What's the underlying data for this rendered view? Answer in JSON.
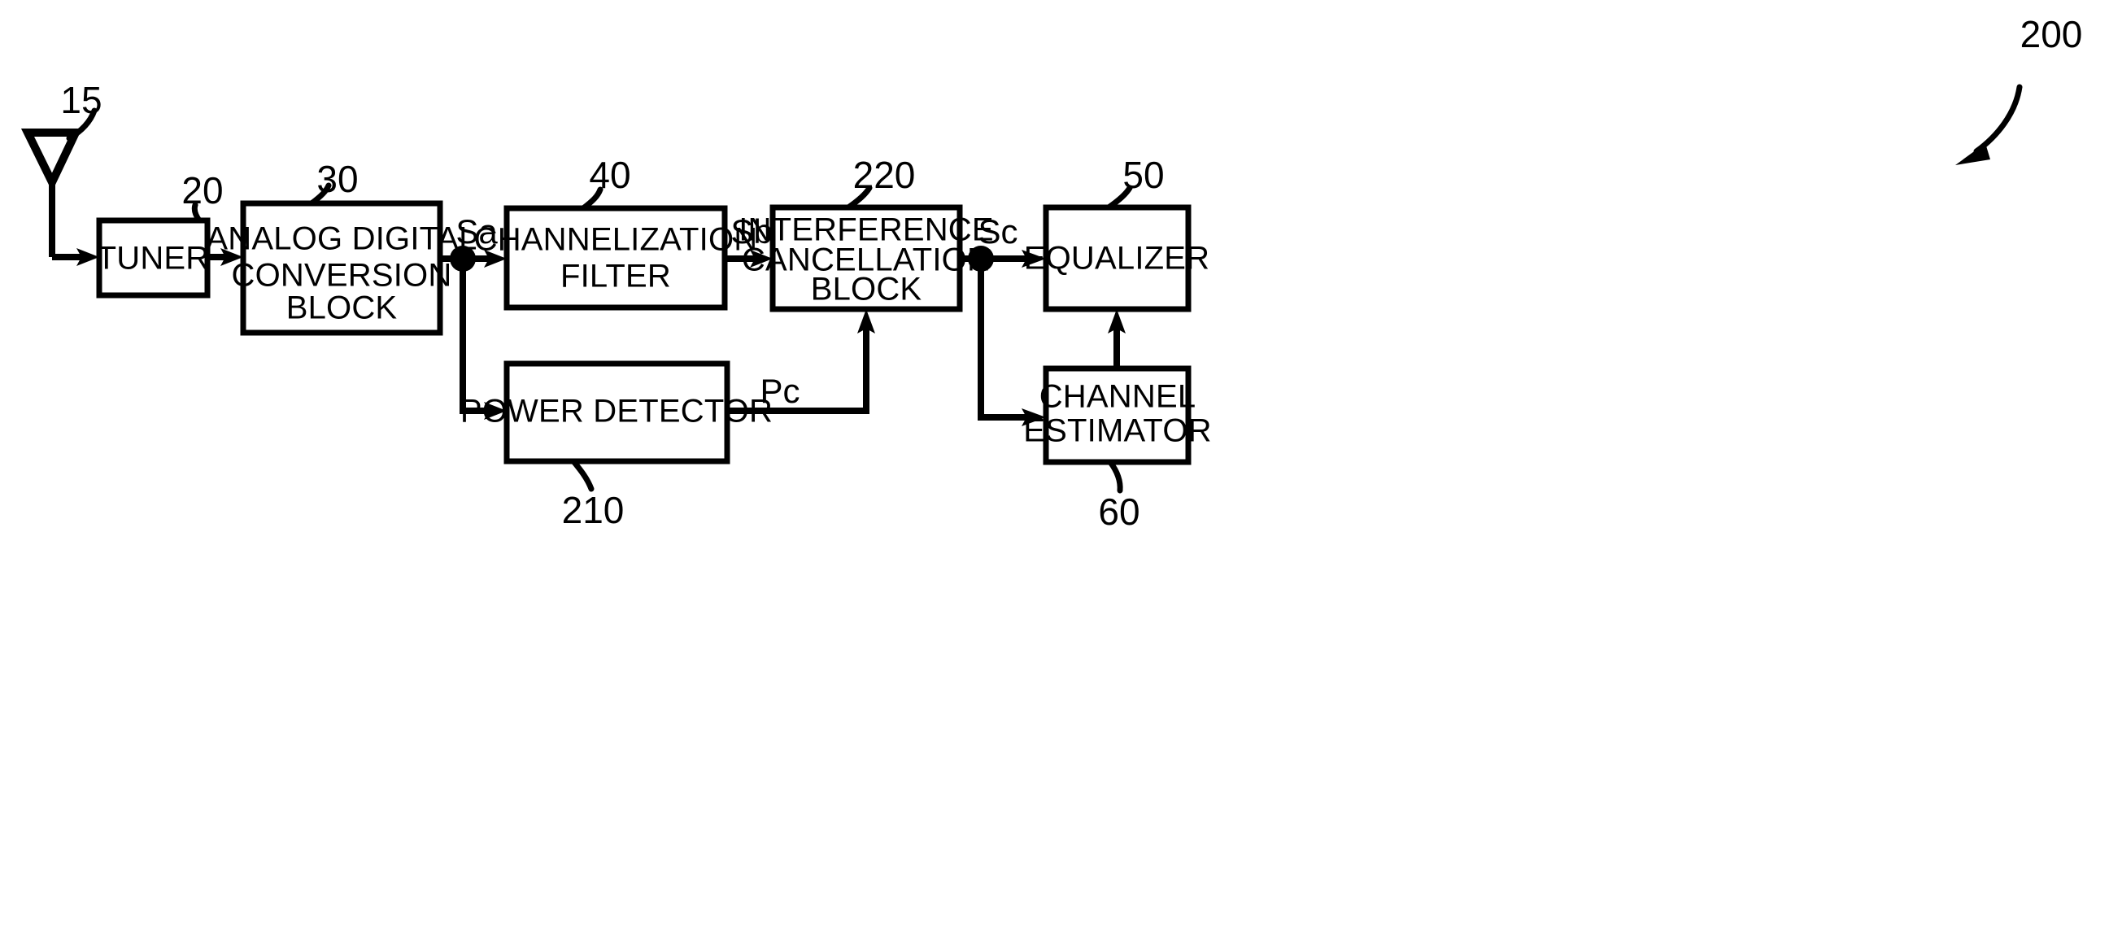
{
  "figure": {
    "kind": "block-diagram",
    "overall_reference": "200",
    "line_color": "#000000",
    "background_color": "#ffffff"
  },
  "blocks": [
    {
      "id": "tuner",
      "lines": [
        "TUNER"
      ],
      "reference": "20"
    },
    {
      "id": "adc",
      "lines": [
        "ANALOG DIGITAL",
        "CONVERSION",
        "BLOCK"
      ],
      "reference": "30"
    },
    {
      "id": "chfilter",
      "lines": [
        "CHANNELIZATION",
        "FILTER"
      ],
      "reference": "40"
    },
    {
      "id": "icblock",
      "lines": [
        "INTERFERENCE",
        "CANCELLATION",
        "BLOCK"
      ],
      "reference": "220"
    },
    {
      "id": "equalizer",
      "lines": [
        "EQUALIZER"
      ],
      "reference": "50"
    },
    {
      "id": "powerdet",
      "lines": [
        "POWER DETECTOR"
      ],
      "reference": "210"
    },
    {
      "id": "chestimator",
      "lines": [
        "CHANNEL",
        "ESTIMATOR"
      ],
      "reference": "60"
    }
  ],
  "antenna": {
    "reference": "15",
    "icon": "antenna-icon"
  },
  "signal_labels": [
    {
      "id": "sa",
      "text": "Sa"
    },
    {
      "id": "sb",
      "text": "Sb"
    },
    {
      "id": "sc",
      "text": "Sc"
    },
    {
      "id": "pc",
      "text": "Pc"
    }
  ],
  "reference_numerals": {
    "antenna": "15",
    "tuner": "20",
    "adc": "30",
    "channelization_filter": "40",
    "interference_cancellation_block": "220",
    "equalizer": "50",
    "power_detector": "210",
    "channel_estimator": "60",
    "receiver": "200"
  }
}
